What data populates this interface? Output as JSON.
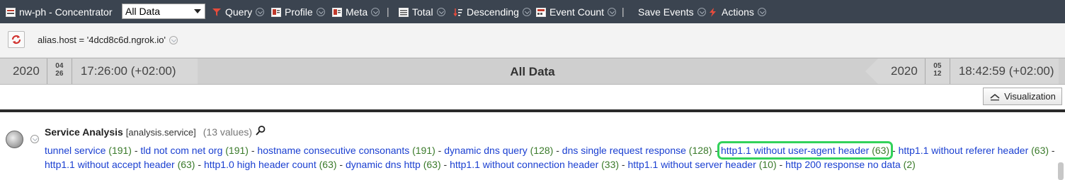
{
  "toolbar": {
    "app_title": "nw-ph - Concentrator",
    "select_value": "All Data",
    "query": "Query",
    "profile": "Profile",
    "meta": "Meta",
    "total": "Total",
    "descending": "Descending",
    "event_count": "Event Count",
    "separator": "|",
    "save_events": "Save Events",
    "actions": "Actions"
  },
  "filter": {
    "text": "alias.host = '4dcd8c6d.ngrok.io'"
  },
  "timeline": {
    "start": {
      "year": "2020",
      "month": "04",
      "day": "26",
      "time": "17:26:00 (+02:00)"
    },
    "label": "All Data",
    "end": {
      "year": "2020",
      "month": "05",
      "day": "12",
      "time": "18:42:59 (+02:00)"
    }
  },
  "visualization_label": "Visualization",
  "section": {
    "title": "Service Analysis",
    "key": "[analysis.service]",
    "count": "(13 values)",
    "values": [
      {
        "label": "tunnel service",
        "count": "(191)"
      },
      {
        "label": "tld not com net org",
        "count": "(191)"
      },
      {
        "label": "hostname consecutive consonants",
        "count": "(191)"
      },
      {
        "label": "dynamic dns query",
        "count": "(128)"
      },
      {
        "label": "dns single request response",
        "count": "(128)"
      },
      {
        "label": "http1.1 without user-agent header",
        "count": "(63)"
      },
      {
        "label": "http1.1 without referer header",
        "count": "(63)"
      },
      {
        "label": "http1.1 without accept header",
        "count": "(63)"
      },
      {
        "label": "http1.0 high header count",
        "count": "(63)"
      },
      {
        "label": "dynamic dns http",
        "count": "(63)"
      },
      {
        "label": "http1.1 without connection header",
        "count": "(33)"
      },
      {
        "label": "http1.1 without server header",
        "count": "(10)"
      },
      {
        "label": "http 200 response no data",
        "count": "(2)"
      }
    ],
    "highlighted": "http1.1 without user-agent header"
  }
}
